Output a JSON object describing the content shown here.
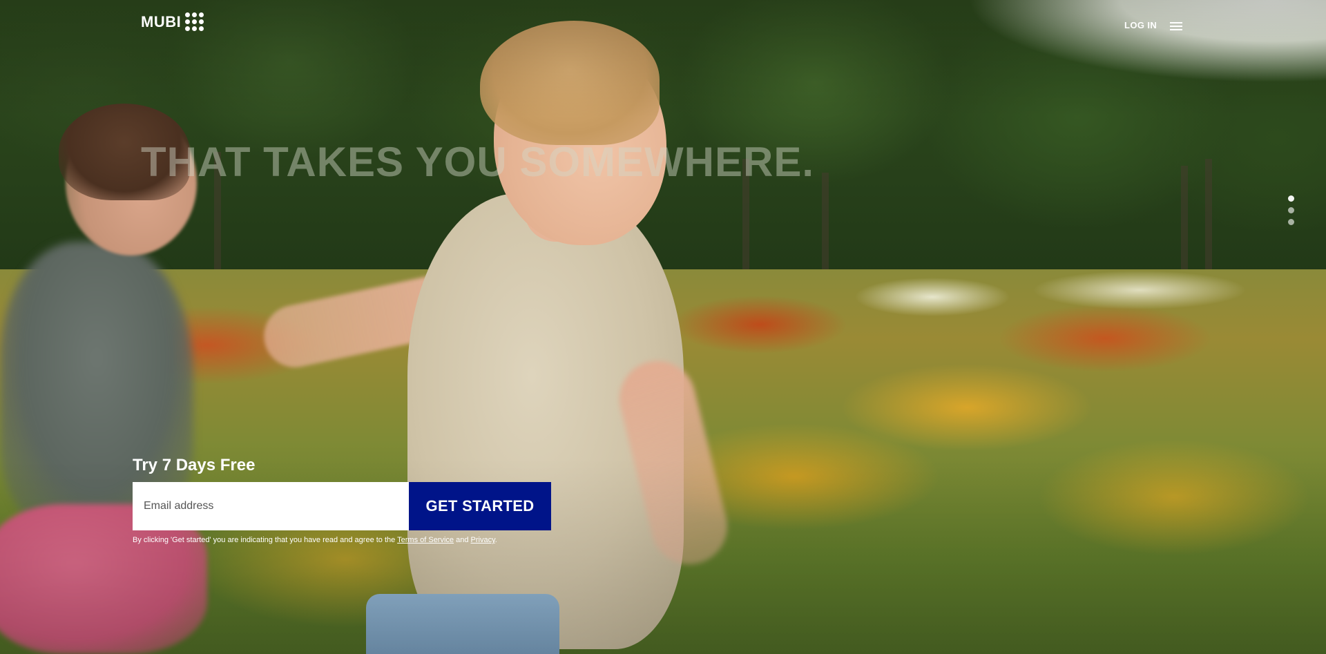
{
  "header": {
    "logo_text": "MUBI",
    "login_label": "LOG IN",
    "menu_icon": "hamburger-menu-icon"
  },
  "hero": {
    "headline": "THAT TAKES YOU SOMEWHERE.",
    "pager": {
      "count": 3,
      "active_index": 0
    }
  },
  "signup": {
    "title": "Try 7 Days Free",
    "email_placeholder": "Email address",
    "email_value": "",
    "cta_label": "GET STARTED",
    "legal_prefix": "By clicking 'Get started' you are indicating that you have read and agree to the ",
    "terms_label": "Terms of Service",
    "legal_and": " and ",
    "privacy_label": "Privacy",
    "legal_suffix": "."
  },
  "colors": {
    "cta_background": "#001489",
    "text": "#ffffff"
  }
}
